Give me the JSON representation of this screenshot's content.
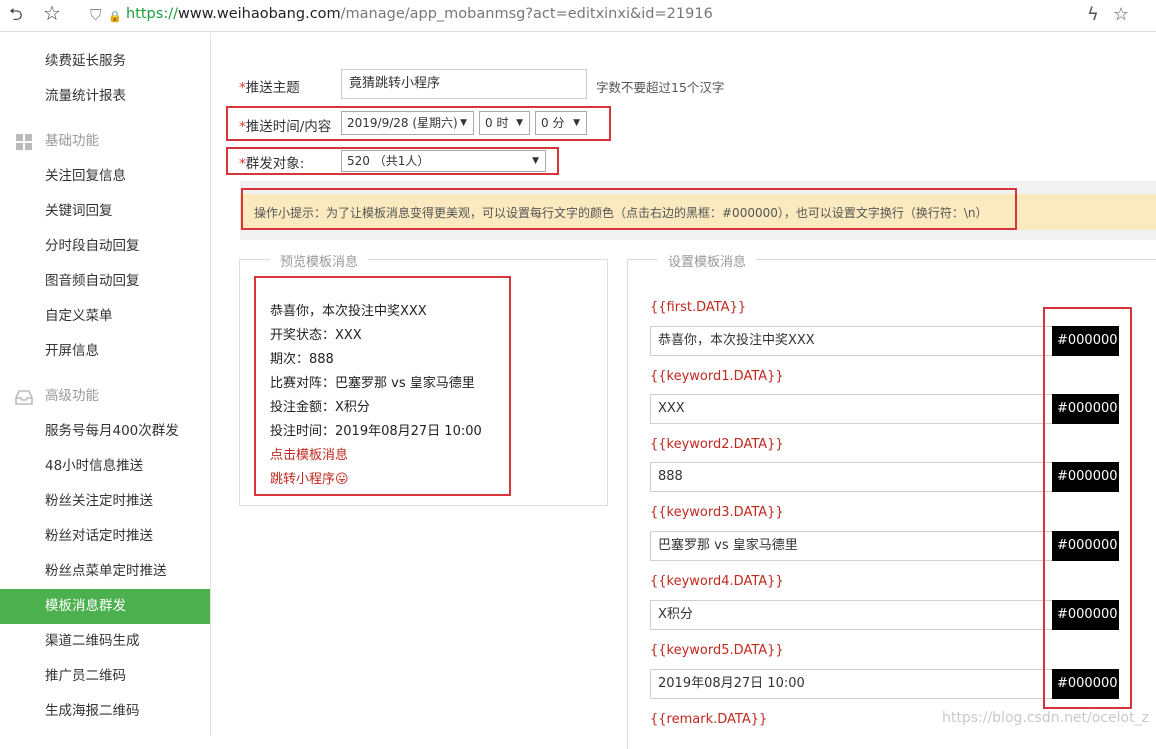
{
  "browser": {
    "url_scheme": "https://",
    "url_host": "www.weihaobang.com",
    "url_path": "/manage/app_mobanmsg?act=editxinxi&id=21916",
    "back_glyph": "⮌",
    "star_glyph": "☆",
    "shield_glyph": "⛉",
    "lock_glyph": "🔒",
    "bolt_glyph": "ϟ"
  },
  "sidebar": {
    "items_top": [
      "续费延长服务",
      "流量统计报表"
    ],
    "group1": "基础功能",
    "group1_items": [
      "关注回复信息",
      "关键词回复",
      "分时段自动回复",
      "图音频自动回复",
      "自定义菜单",
      "开屏信息"
    ],
    "group2": "高级功能",
    "group2_items": [
      "服务号每月400次群发",
      "48小时信息推送",
      "粉丝关注定时推送",
      "粉丝对话定时推送",
      "粉丝点菜单定时推送",
      "模板消息群发",
      "渠道二维码生成",
      "推广员二维码",
      "生成海报二维码"
    ],
    "active_item": "模板消息群发",
    "active_color": "#4cb04f"
  },
  "form": {
    "required_mark": "*",
    "subject_label": "推送主题",
    "subject_value": "竟猜跳转小程序",
    "subject_hint": "字数不要超过15个汉字",
    "time_label": "推送时间/内容",
    "date_value": "2019/9/28 (星期六)",
    "hour_value": "0 时",
    "minute_value": "0 分",
    "target_label": "群发对象:",
    "target_value": "520 （共1人）",
    "arrow_glyph": "▼"
  },
  "tip": "操作小提示：为了让模板消息变得更美观，可以设置每行文字的颜色（点击右边的黑框：#000000），也可以设置文字换行（换行符：\\n）",
  "preview": {
    "title": "预览模板消息",
    "lines": [
      "恭喜你，本次投注中奖XXX",
      "开奖状态：XXX",
      "期次：888",
      "比赛对阵：巴塞罗那 vs 皇家马德里",
      "投注金额：X积分",
      "投注时间：2019年08月27日 10:00"
    ],
    "link1": "点击模板消息",
    "link2": "跳转小程序",
    "emoji": "😛"
  },
  "settings": {
    "title": "设置模板消息",
    "fields": [
      {
        "label": "{{first.DATA}}",
        "value": "恭喜你，本次投注中奖XXX",
        "color": "#000000"
      },
      {
        "label": "{{keyword1.DATA}}",
        "value": "XXX",
        "color": "#000000"
      },
      {
        "label": "{{keyword2.DATA}}",
        "value": "888",
        "color": "#000000"
      },
      {
        "label": "{{keyword3.DATA}}",
        "value": "巴塞罗那 vs 皇家马德里",
        "color": "#000000"
      },
      {
        "label": "{{keyword4.DATA}}",
        "value": "X积分",
        "color": "#000000"
      },
      {
        "label": "{{keyword5.DATA}}",
        "value": "2019年08月27日 10:00",
        "color": "#000000"
      }
    ],
    "remark_label": "{{remark.DATA}}"
  },
  "watermark": "https://blog.csdn.net/ocelot_z"
}
